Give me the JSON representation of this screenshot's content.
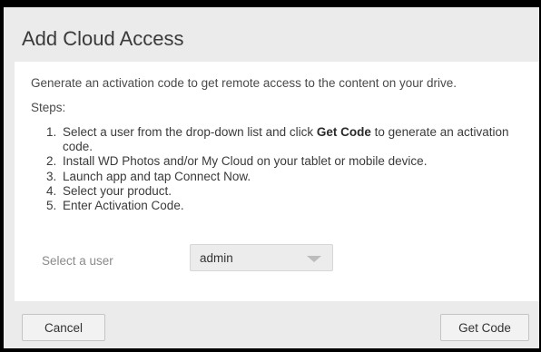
{
  "dialog": {
    "title": "Add Cloud Access",
    "intro": "Generate an activation code to get remote access to the content on your drive.",
    "steps_label": "Steps:",
    "steps": [
      {
        "number": "1.",
        "before": "Select a user from the drop-down list and click ",
        "bold": "Get Code",
        "after": " to generate an activation code."
      },
      {
        "number": "2.",
        "text": "Install WD Photos and/or My Cloud on your tablet or mobile device."
      },
      {
        "number": "3.",
        "text": "Launch app and tap Connect Now."
      },
      {
        "number": "4.",
        "text": "Select your product."
      },
      {
        "number": "5.",
        "text": "Enter Activation Code."
      }
    ],
    "select_user": {
      "label": "Select a user",
      "value": "admin"
    },
    "buttons": {
      "cancel": "Cancel",
      "get_code": "Get Code"
    }
  },
  "colors": {
    "background": "#000000",
    "dialog": "#ebebeb",
    "panel": "#ffffff",
    "title_text": "#3a3a3a",
    "muted_text": "#8a8a8a",
    "caret": "#bcbcbc"
  },
  "icons": {
    "dropdown": "chevron-down-icon"
  }
}
